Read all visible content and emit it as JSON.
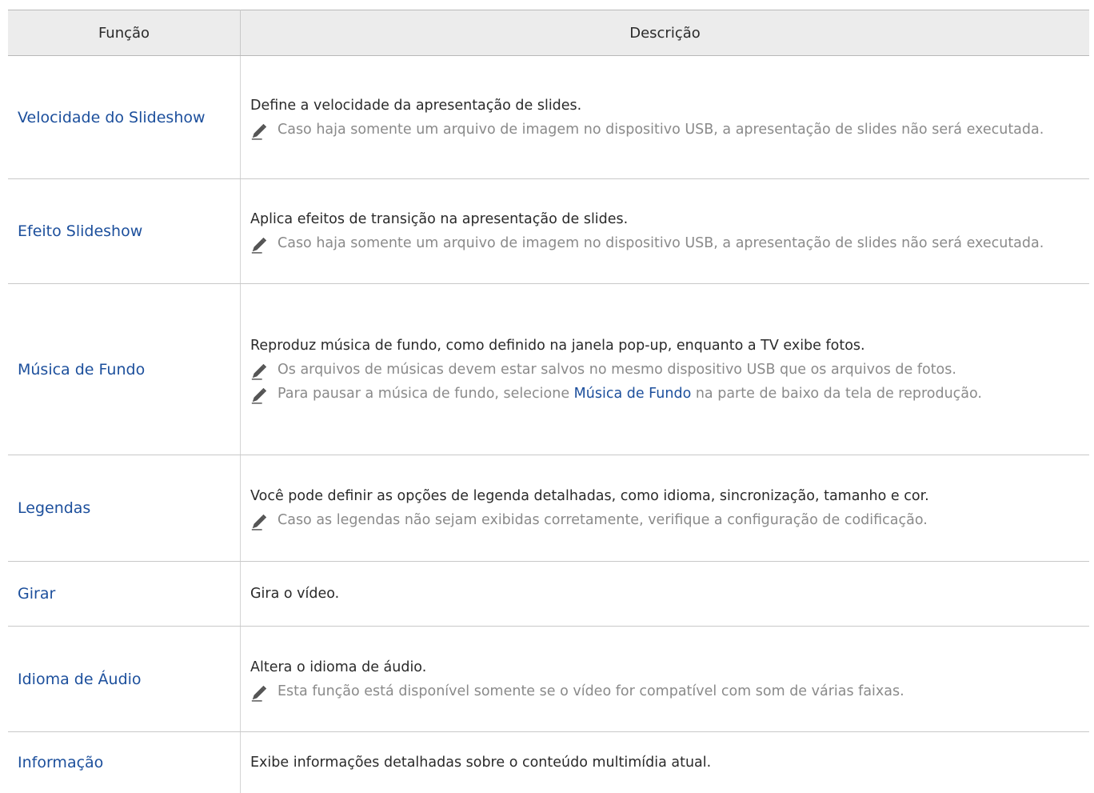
{
  "table": {
    "headers": {
      "function": "Função",
      "description": "Descrição"
    },
    "rows": [
      {
        "function": "Velocidade do Slideshow",
        "description": "Define a velocidade da apresentação de slides.",
        "notes": [
          "Caso haja somente um arquivo de imagem no dispositivo USB, a apresentação de slides não será executada."
        ]
      },
      {
        "function": "Efeito Slideshow",
        "description": "Aplica efeitos de transição na apresentação de slides.",
        "notes": [
          "Caso haja somente um arquivo de imagem no dispositivo USB, a apresentação de slides não será executada."
        ]
      },
      {
        "function": "Música de Fundo",
        "description": "Reproduz música de fundo, como definido na janela pop-up, enquanto a TV exibe fotos.",
        "notes": [
          "Os arquivos de músicas devem estar salvos no mesmo dispositivo USB que os arquivos de fotos.",
          {
            "before": "Para pausar a música de fundo, selecione ",
            "link": "Música de Fundo",
            "after": " na parte de baixo da tela de reprodução."
          }
        ]
      },
      {
        "function": "Legendas",
        "description": "Você pode definir as opções de legenda detalhadas, como idioma, sincronização, tamanho e cor.",
        "notes": [
          "Caso as legendas não sejam exibidas corretamente, verifique a configuração de codificação."
        ]
      },
      {
        "function": "Girar",
        "description": "Gira o vídeo.",
        "notes": []
      },
      {
        "function": "Idioma de Áudio",
        "description": "Altera o idioma de áudio.",
        "notes": [
          "Esta função está disponível somente se o vídeo for compatível com som de várias faixas."
        ]
      },
      {
        "function": "Informação",
        "description": "Exibe informações detalhadas sobre o conteúdo multimídia atual.",
        "notes": []
      }
    ]
  },
  "icons": {
    "note": "pencil-note-icon"
  },
  "colors": {
    "function_text": "#1c4f9c",
    "note_text": "#8a8a8a",
    "header_bg": "#ececec"
  }
}
